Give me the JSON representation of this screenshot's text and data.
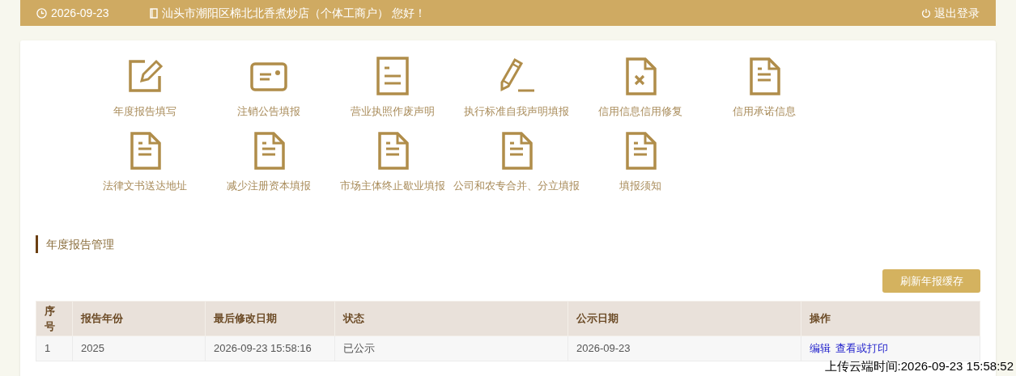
{
  "header": {
    "date": "2026-09-23",
    "greeting": "汕头市潮阳区棉北北香煮炒店（个体工商户） 您好！",
    "logout": "退出登录"
  },
  "menu": [
    {
      "label": "年度报告填写"
    },
    {
      "label": "注销公告填报"
    },
    {
      "label": "营业执照作废声明"
    },
    {
      "label": "执行标准自我声明填报"
    },
    {
      "label": "信用信息信用修复"
    },
    {
      "label": "信用承诺信息"
    },
    {
      "label": "法律文书送达地址"
    },
    {
      "label": "减少注册资本填报"
    },
    {
      "label": "市场主体终止歇业填报"
    },
    {
      "label": "公司和农专合并、分立填报"
    },
    {
      "label": "填报须知"
    }
  ],
  "section": {
    "title": "年度报告管理",
    "refresh_button": "刷新年报缓存"
  },
  "table": {
    "columns": [
      "序号",
      "报告年份",
      "最后修改日期",
      "状态",
      "公示日期",
      "操作"
    ],
    "rows": [
      {
        "cells": [
          "1",
          "2025",
          "2026-09-23 15:58:16",
          "已公示",
          "2026-09-23"
        ],
        "actions": [
          "编辑",
          "查看或打印"
        ]
      }
    ]
  },
  "upload_time": "上传云端时间:2026-09-23 15:58:52"
}
